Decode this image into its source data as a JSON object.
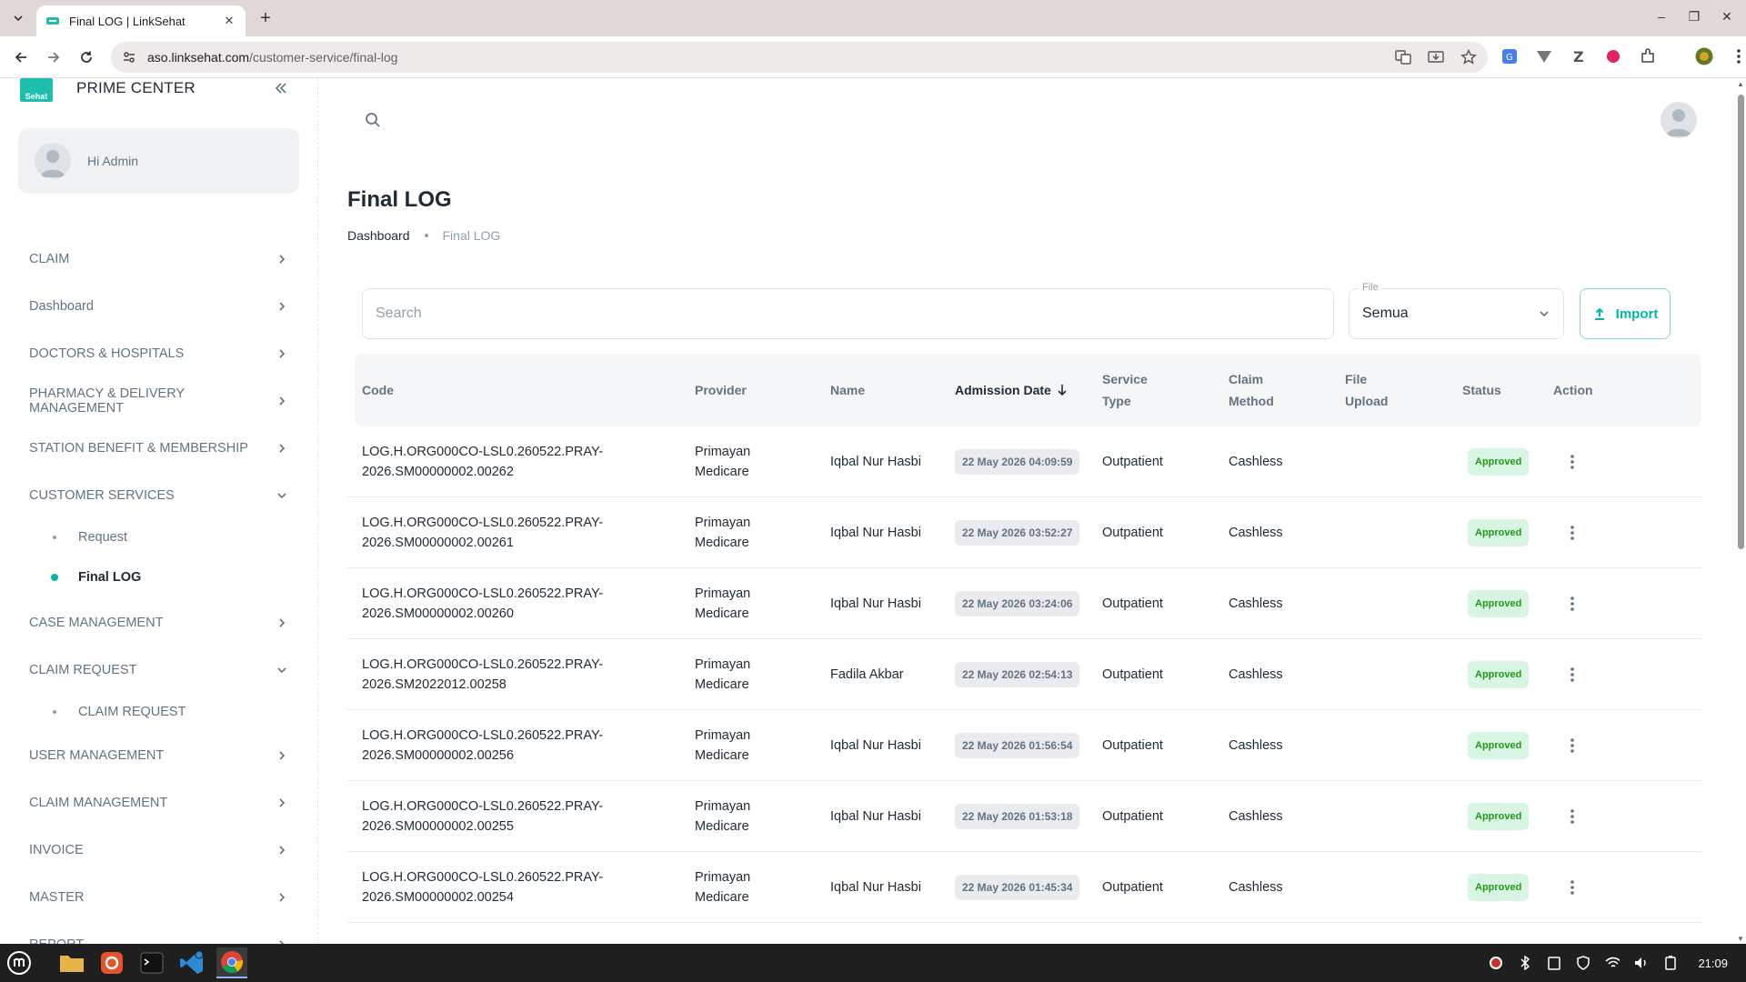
{
  "browser": {
    "tab_title": "Final LOG | LinkSehat",
    "url_host": "aso.linksehat.com",
    "url_path": "/customer-service/final-log"
  },
  "sidebar": {
    "logo_text": "Sehat",
    "brand": "PRIME CENTER",
    "greeting": "Hi Admin",
    "items": [
      {
        "label": "CLAIM",
        "expanded": false
      },
      {
        "label": "Dashboard",
        "expanded": false
      },
      {
        "label": "DOCTORS & HOSPITALS",
        "expanded": false
      },
      {
        "label": "PHARMACY & DELIVERY MANAGEMENT",
        "expanded": false
      },
      {
        "label": "STATION BENEFIT & MEMBERSHIP",
        "expanded": false
      },
      {
        "label": "CUSTOMER SERVICES",
        "expanded": true
      },
      {
        "label": "CASE MANAGEMENT",
        "expanded": false
      },
      {
        "label": "CLAIM REQUEST",
        "expanded": true
      },
      {
        "label": "USER MANAGEMENT",
        "expanded": false
      },
      {
        "label": "CLAIM MANAGEMENT",
        "expanded": false
      },
      {
        "label": "INVOICE",
        "expanded": false
      },
      {
        "label": "MASTER",
        "expanded": false
      },
      {
        "label": "REPORT",
        "expanded": false
      }
    ],
    "customer_services_sub": [
      {
        "label": "Request",
        "active": false
      },
      {
        "label": "Final LOG",
        "active": true
      }
    ],
    "claim_request_sub": [
      {
        "label": "CLAIM REQUEST",
        "active": false
      }
    ]
  },
  "page": {
    "title": "Final LOG",
    "breadcrumb": [
      "Dashboard",
      "Final LOG"
    ]
  },
  "filters": {
    "search_placeholder": "Search",
    "file_label": "File",
    "file_value": "Semua",
    "import_label": "Import"
  },
  "table": {
    "columns": [
      "Code",
      "Provider",
      "Name",
      "Admission Date",
      "Service\nType",
      "Claim\nMethod",
      "File\nUpload",
      "Status",
      "Action"
    ],
    "rows": [
      {
        "code": "LOG.H.ORG000CO-LSL0.260522.PRAY-\n2026.SM00000002.00262",
        "provider": "Primayan\nMedicare",
        "name": "Iqbal Nur Hasbi",
        "date": "22 May 2026 04:09:59",
        "service": "Outpatient",
        "method": "Cashless",
        "file": "",
        "status": "Approved"
      },
      {
        "code": "LOG.H.ORG000CO-LSL0.260522.PRAY-\n2026.SM00000002.00261",
        "provider": "Primayan\nMedicare",
        "name": "Iqbal Nur Hasbi",
        "date": "22 May 2026 03:52:27",
        "service": "Outpatient",
        "method": "Cashless",
        "file": "",
        "status": "Approved"
      },
      {
        "code": "LOG.H.ORG000CO-LSL0.260522.PRAY-\n2026.SM00000002.00260",
        "provider": "Primayan\nMedicare",
        "name": "Iqbal Nur Hasbi",
        "date": "22 May 2026 03:24:06",
        "service": "Outpatient",
        "method": "Cashless",
        "file": "",
        "status": "Approved"
      },
      {
        "code": "LOG.H.ORG000CO-LSL0.260522.PRAY-\n2026.SM2022012.00258",
        "provider": "Primayan\nMedicare",
        "name": "Fadila Akbar",
        "date": "22 May 2026 02:54:13",
        "service": "Outpatient",
        "method": "Cashless",
        "file": "",
        "status": "Approved"
      },
      {
        "code": "LOG.H.ORG000CO-LSL0.260522.PRAY-\n2026.SM00000002.00256",
        "provider": "Primayan\nMedicare",
        "name": "Iqbal Nur Hasbi",
        "date": "22 May 2026 01:56:54",
        "service": "Outpatient",
        "method": "Cashless",
        "file": "",
        "status": "Approved"
      },
      {
        "code": "LOG.H.ORG000CO-LSL0.260522.PRAY-\n2026.SM00000002.00255",
        "provider": "Primayan\nMedicare",
        "name": "Iqbal Nur Hasbi",
        "date": "22 May 2026 01:53:18",
        "service": "Outpatient",
        "method": "Cashless",
        "file": "",
        "status": "Approved"
      },
      {
        "code": "LOG.H.ORG000CO-LSL0.260522.PRAY-\n2026.SM00000002.00254",
        "provider": "Primayan\nMedicare",
        "name": "Iqbal Nur Hasbi",
        "date": "22 May 2026 01:45:34",
        "service": "Outpatient",
        "method": "Cashless",
        "file": "",
        "status": "Approved"
      }
    ]
  },
  "taskbar": {
    "clock": "21:09"
  },
  "colors": {
    "accent": "#00b8a9",
    "approved_bg": "#d7f5e2",
    "approved_fg": "#229a16"
  }
}
